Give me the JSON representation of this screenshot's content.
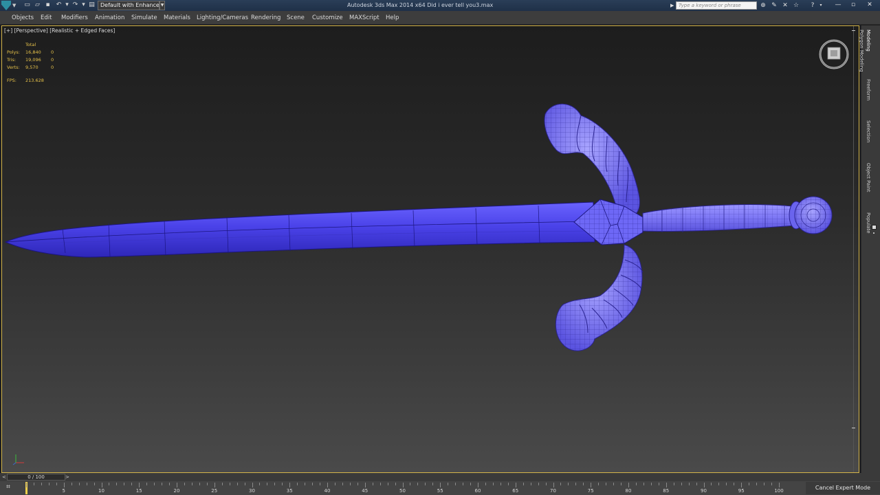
{
  "titlebar": {
    "workspace": "Default with Enhance",
    "window_title": "Autodesk 3ds Max  2014 x64      Did i ever tell you3.max",
    "search_placeholder": "Type a keyword or phrase"
  },
  "menu": [
    "Objects",
    "Edit",
    "Modifiers",
    "Animation",
    "Simulate",
    "Materials",
    "Lighting/Cameras",
    "Rendering",
    "Scene",
    "Customize",
    "MAXScript",
    "Help"
  ],
  "viewport": {
    "label_parts": [
      "[+]",
      "[Perspective]",
      "[Realistic + Edged Faces]"
    ],
    "stats": {
      "header": "Total",
      "rows": [
        {
          "label": "Polys:",
          "total": "16,840",
          "sel": "0"
        },
        {
          "label": "Tris:",
          "total": "19,096",
          "sel": "0"
        },
        {
          "label": "Verts:",
          "total": "9,570",
          "sel": "0"
        }
      ],
      "fps_label": "FPS:",
      "fps_value": "213.628"
    },
    "mesh_color": "#4a42e8",
    "mesh_light": "#8c86ff",
    "wire_color": "#1c1680"
  },
  "ribbon_tabs": [
    "Modeling",
    "Freeform",
    "Selection",
    "Object Paint",
    "Populate"
  ],
  "ribbon_subtab": "Polygon Modeling",
  "time_slider": {
    "value": "0 / 100"
  },
  "track": {
    "labels": [
      "5",
      "10",
      "15",
      "20",
      "25",
      "30",
      "35",
      "40",
      "45",
      "50",
      "55",
      "60",
      "65",
      "70",
      "75",
      "80",
      "85",
      "90",
      "95",
      "100"
    ],
    "expert_button": "Cancel Expert Mode"
  },
  "icons": [
    "app-logo-icon",
    "new-file-icon",
    "open-file-icon",
    "save-icon",
    "undo-icon",
    "redo-icon",
    "project-folder-icon",
    "binoculars-icon",
    "tools-icon",
    "star-icon",
    "help-icon",
    "minimize-icon",
    "maximize-icon",
    "close-icon",
    "viewcube-icon",
    "axis-gizmo-icon",
    "mini-curve-editor-icon"
  ]
}
